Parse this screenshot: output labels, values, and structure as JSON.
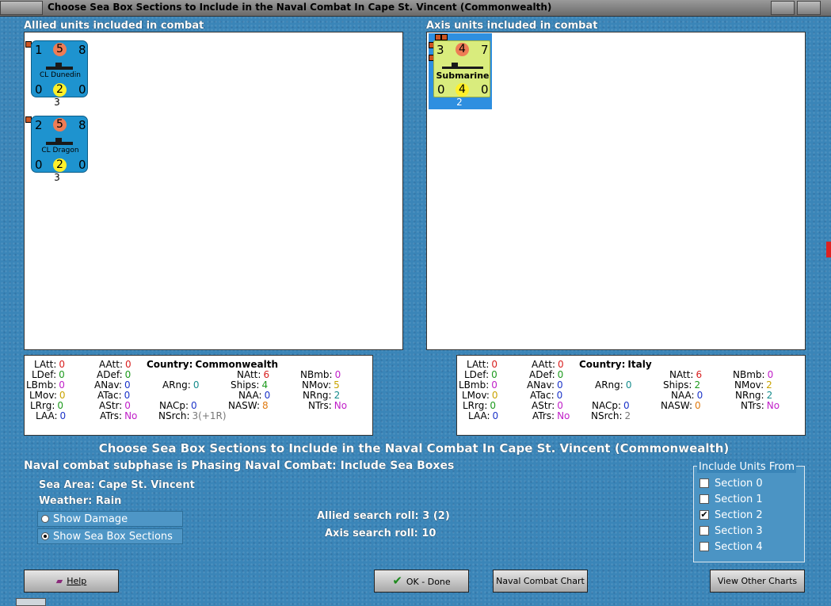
{
  "window": {
    "title": "Choose Sea Box Sections to Include in the Naval Combat In Cape St. Vincent (Commonwealth)"
  },
  "allied": {
    "header": "Allied units included in combat",
    "units": [
      {
        "top_left": "1",
        "top_mid": "5",
        "top_right": "8",
        "name": "CL Dunedin",
        "bot_left": "0",
        "bot_mid": "2",
        "bot_right": "0",
        "below": "3"
      },
      {
        "top_left": "2",
        "top_mid": "5",
        "top_right": "8",
        "name": "CL Dragon",
        "bot_left": "0",
        "bot_mid": "2",
        "bot_right": "0",
        "below": "3"
      }
    ],
    "stats": {
      "LAtt": "0",
      "LDef": "0",
      "LBmb": "0",
      "LMov": "0",
      "LRrg": "0",
      "LAA": "0",
      "AAtt": "0",
      "ADef": "0",
      "ANav": "0",
      "ATac": "0",
      "AStr": "0",
      "ATrs": "No",
      "country_label": "Country:",
      "country": "Commonwealth",
      "ARng": "0",
      "NACp": "0",
      "NSrch": "3(+1R)",
      "NAtt": "6",
      "Ships": "4",
      "NAA": "0",
      "NASW": "8",
      "NBmb": "0",
      "NMov": "5",
      "NRng": "2",
      "NTrs": "No"
    }
  },
  "axis": {
    "header": "Axis units included in combat",
    "units": [
      {
        "top_left": "3",
        "top_mid": "4",
        "top_right": "7",
        "name": "Submarine",
        "bot_left": "0",
        "bot_mid": "4",
        "bot_right": "0",
        "below": "2"
      }
    ],
    "stats": {
      "LAtt": "0",
      "LDef": "0",
      "LBmb": "0",
      "LMov": "0",
      "LRrg": "0",
      "LAA": "0",
      "AAtt": "0",
      "ADef": "0",
      "ANav": "0",
      "ATac": "0",
      "AStr": "0",
      "ATrs": "No",
      "country_label": "Country:",
      "country": "Italy",
      "ARng": "0",
      "NACp": "0",
      "NSrch": "2",
      "NAtt": "6",
      "Ships": "2",
      "NAA": "0",
      "NASW": "0",
      "NBmb": "0",
      "NMov": "2",
      "NRng": "2",
      "NTrs": "No"
    }
  },
  "labels": {
    "LAtt": "LAtt:",
    "LDef": "LDef:",
    "LBmb": "LBmb:",
    "LMov": "LMov:",
    "LRrg": "LRrg:",
    "LAA": "LAA:",
    "AAtt": "AAtt:",
    "ADef": "ADef:",
    "ANav": "ANav:",
    "ATac": "ATac:",
    "AStr": "AStr:",
    "ATrs": "ATrs:",
    "ARng": "ARng:",
    "NACp": "NACp:",
    "NSrch": "NSrch:",
    "NAtt": "NAtt:",
    "Ships": "Ships:",
    "NAA": "NAA:",
    "NASW": "NASW:",
    "NBmb": "NBmb:",
    "NMov": "NMov:",
    "NRng": "NRng:",
    "NTrs": "NTrs:"
  },
  "heading": "Choose Sea Box Sections to Include in the Naval Combat In Cape St. Vincent (Commonwealth)",
  "subphase": "Naval combat subphase is Phasing Naval Combat: Include Sea Boxes",
  "sea_area_label": "Sea Area:",
  "sea_area": "Cape St. Vincent",
  "weather_label": "Weather:",
  "weather": "Rain",
  "options": [
    {
      "label": "Show Damage",
      "selected": false
    },
    {
      "label": "Show Sea Box Sections",
      "selected": true
    }
  ],
  "allied_roll_label": "Allied search roll:",
  "allied_roll": "3 (2)",
  "axis_roll_label": "Axis search roll:",
  "axis_roll": "10",
  "include_group": {
    "title": "Include Units From",
    "sections": [
      {
        "label": "Section 0",
        "checked": false
      },
      {
        "label": "Section 1",
        "checked": false
      },
      {
        "label": "Section 2",
        "checked": true
      },
      {
        "label": "Section 3",
        "checked": false
      },
      {
        "label": "Section 4",
        "checked": false
      }
    ]
  },
  "buttons": {
    "help": "Help",
    "ok": "OK - Done",
    "naval_chart": "Naval Combat Chart",
    "other_charts": "View Other Charts"
  },
  "icons": {
    "help": "book-icon",
    "ok": "checkmark-icon"
  },
  "colors": {
    "background": "#3a85b8",
    "allied_counter": "#1e93cf",
    "axis_counter": "#d9ec7d",
    "attack_circle": "#ee7c55",
    "defense_circle": "#fff02a"
  }
}
